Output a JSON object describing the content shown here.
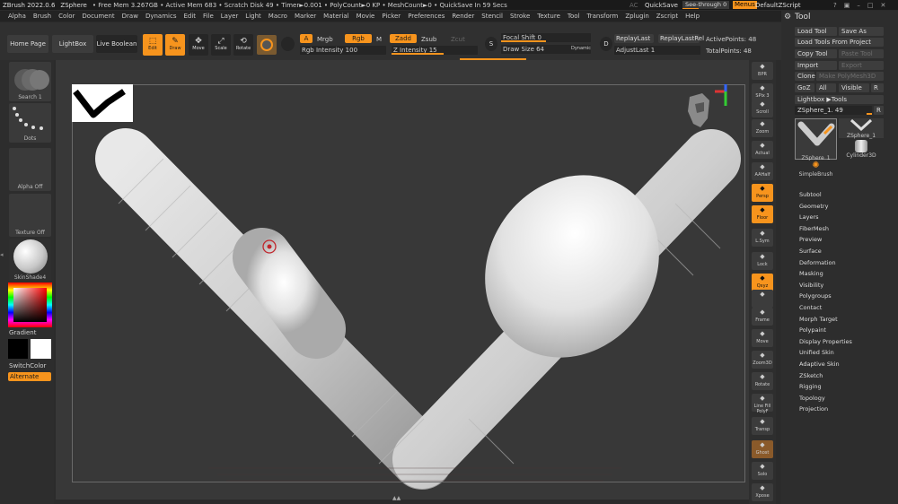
{
  "titlebar": {
    "app": "ZBrush 2022.0.6",
    "tool": "ZSphere",
    "stats": "• Free Mem 3.267GB • Active Mem 683 • Scratch Disk 49 • Timer►0.001 • PolyCount►0 KP • MeshCount►0 • QuickSave In 59 Secs",
    "ac": "AC",
    "quicksave": "QuickSave",
    "seethrough": "See-through   0",
    "menus": "Menus",
    "script": "DefaultZScript"
  },
  "menubar": [
    "Alpha",
    "Brush",
    "Color",
    "Document",
    "Draw",
    "Dynamics",
    "Edit",
    "File",
    "Layer",
    "Light",
    "Macro",
    "Marker",
    "Material",
    "Movie",
    "Picker",
    "Preferences",
    "Render",
    "Stencil",
    "Stroke",
    "Texture",
    "Tool",
    "Transform",
    "Zplugin",
    "Zscript",
    "Help"
  ],
  "shelf": {
    "home": "Home Page",
    "lightbox": "LightBox",
    "liveboolean": "Live Boolean",
    "edit": "Edit",
    "draw": "Draw",
    "move": "Move",
    "scale": "Scale",
    "rotate": "Rotate",
    "a": "A",
    "mrgb": "Mrgb",
    "rgb": "Rgb",
    "m": "M",
    "zadd": "Zadd",
    "zsub": "Zsub",
    "zcut": "Zcut",
    "rgb_intensity": "Rgb Intensity 100",
    "z_intensity": "Z Intensity 15",
    "focal_shift": "Focal Shift 0",
    "draw_size": "Draw Size 64",
    "dynamic": "Dynamic",
    "replaylast": "ReplayLast",
    "replaylastrel": "ReplayLastRel",
    "adjustlast": "AdjustLast 1",
    "active_points": "ActivePoints: 48",
    "total_points": "TotalPoints: 48"
  },
  "lefttray": {
    "brush": "Search 1",
    "stroke": "Dots",
    "alpha": "Alpha Off",
    "texture": "Texture Off",
    "material": "SkinShade4",
    "gradient": "Gradient",
    "switchcolor": "SwitchColor",
    "alternate": "Alternate"
  },
  "rightshelf": [
    "BPR",
    "SPix 3",
    "Scroll",
    "Zoom",
    "Actual",
    "AAHalf",
    "Persp",
    "Floor",
    "L.Sym",
    "Lock",
    "Qxyz",
    "",
    "Frame",
    "Move",
    "Zoom3D",
    "Rotate",
    "Line Fill PolyF",
    "Transp",
    "Ghost",
    "Solo",
    "Xpose"
  ],
  "toolpalette": {
    "title": "Tool",
    "load_tool": "Load Tool",
    "save_as": "Save As",
    "load_from_project": "Load Tools From Project",
    "copy_tool": "Copy Tool",
    "paste_tool": "Paste Tool",
    "import": "Import",
    "export": "Export",
    "clone": "Clone",
    "make_polymesh": "Make PolyMesh3D",
    "goz": "GoZ",
    "all": "All",
    "visible": "Visible",
    "r": "R",
    "lightbox_tools": "Lightbox ▶Tools",
    "zsphere_slider": "ZSphere_1. 49",
    "thumbs": [
      "ZSphere_1",
      "ZSphere_1",
      "Cylinder3D",
      "SimpleBrush"
    ],
    "subpalettes": [
      "Subtool",
      "Geometry",
      "Layers",
      "FiberMesh",
      "Preview",
      "Surface",
      "Deformation",
      "Masking",
      "Visibility",
      "Polygroups",
      "Contact",
      "Morph Target",
      "Polypaint",
      "Display Properties",
      "Unified Skin",
      "Adaptive Skin",
      "ZSketch",
      "Rigging",
      "Topology",
      "Projection"
    ]
  },
  "colors": {
    "accent": "#f7941d",
    "bg": "#2b2b2b",
    "canvas": "#383838"
  }
}
